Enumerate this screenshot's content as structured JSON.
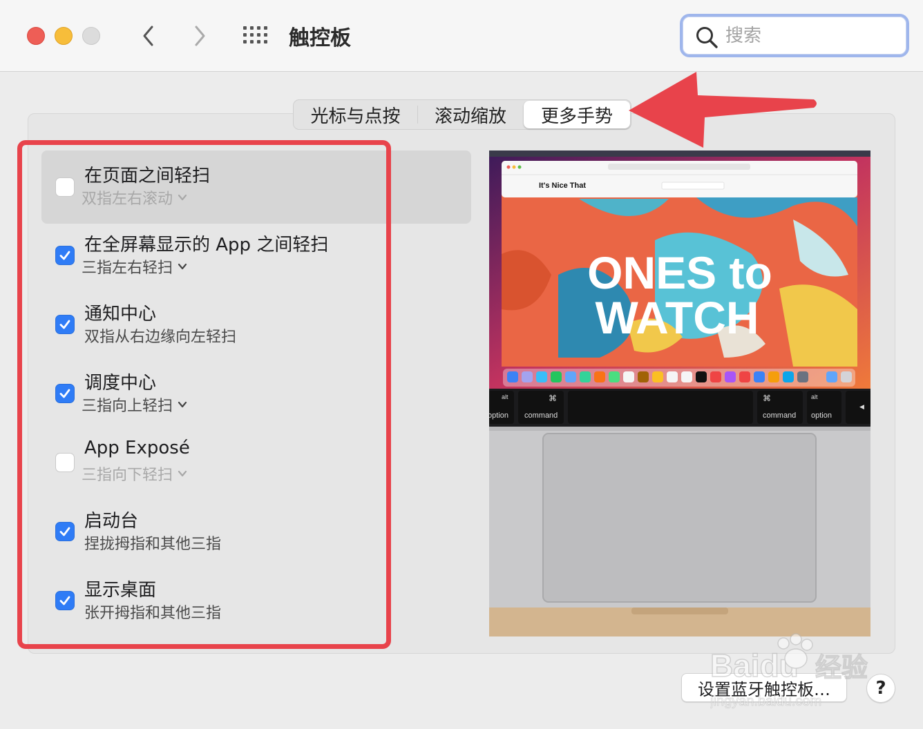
{
  "window": {
    "title": "触控板"
  },
  "search": {
    "placeholder": "搜索"
  },
  "tabs": [
    {
      "label": "光标与点按",
      "selected": false
    },
    {
      "label": "滚动缩放",
      "selected": false
    },
    {
      "label": "更多手势",
      "selected": true
    }
  ],
  "gestures": [
    {
      "title": "在页面之间轻扫",
      "subtitle": "双指左右滚动",
      "checked": false,
      "has_dropdown": true,
      "selected": true
    },
    {
      "title": "在全屏幕显示的 App 之间轻扫",
      "subtitle": "三指左右轻扫",
      "checked": true,
      "has_dropdown": true
    },
    {
      "title": "通知中心",
      "subtitle": "双指从右边缘向左轻扫",
      "checked": true,
      "has_dropdown": false
    },
    {
      "title": "调度中心",
      "subtitle": "三指向上轻扫",
      "checked": true,
      "has_dropdown": true
    },
    {
      "title": "App Exposé",
      "subtitle": "三指向下轻扫",
      "checked": false,
      "has_dropdown": true
    },
    {
      "title": "启动台",
      "subtitle": "捏拢拇指和其他三指",
      "checked": true,
      "has_dropdown": false
    },
    {
      "title": "显示桌面",
      "subtitle": "张开拇指和其他三指",
      "checked": true,
      "has_dropdown": false
    }
  ],
  "preview": {
    "browser_brand": "It's Nice That",
    "headline_1": "ONES to",
    "headline_2": "WATCH",
    "keys": {
      "left_option": "option",
      "left_alt": "alt",
      "left_command": "command",
      "right_command": "command",
      "right_alt": "alt",
      "right_option": "option"
    }
  },
  "bottom": {
    "bluetooth_button": "设置蓝牙触控板…",
    "help": "?"
  },
  "watermark": {
    "text_1": "Baidu",
    "text_2": "经验",
    "url": "jingyan.baidu.com"
  },
  "colors": {
    "accent": "#2f7cf6",
    "annotation_red": "#e8434b",
    "search_focus": "#9fb6ec"
  }
}
